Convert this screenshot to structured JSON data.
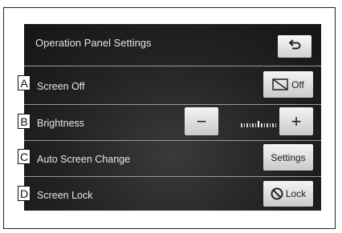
{
  "window": {
    "title": "Operation Panel Settings"
  },
  "rows": [
    {
      "marker": "A",
      "label": "Screen Off",
      "button_label": "Off"
    },
    {
      "marker": "B",
      "label": "Brightness",
      "minus_label": "−",
      "plus_label": "+"
    },
    {
      "marker": "C",
      "label": "Auto Screen Change",
      "button_label": "Settings"
    },
    {
      "marker": "D",
      "label": "Screen Lock",
      "button_label": "Lock"
    }
  ],
  "icons": {
    "back": "back-arrow-icon",
    "screen_off": "screen-off-icon",
    "lock": "no-entry-icon"
  }
}
